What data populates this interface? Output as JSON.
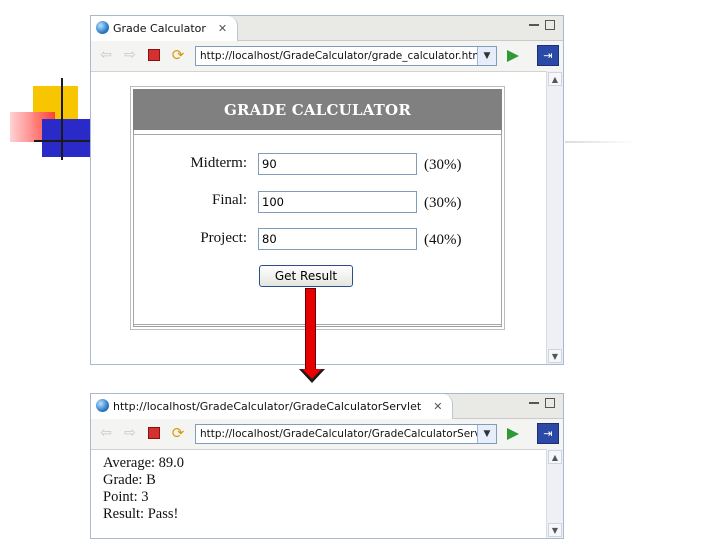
{
  "window1": {
    "tab_title": "Grade Calculator",
    "url": "http://localhost/GradeCalculator/grade_calculator.html"
  },
  "form": {
    "title": "GRADE CALCULATOR",
    "fields": [
      {
        "label": "Midterm:",
        "value": "90",
        "weight": "(30%)"
      },
      {
        "label": "Final:",
        "value": "100",
        "weight": "(30%)"
      },
      {
        "label": "Project:",
        "value": "80",
        "weight": "(40%)"
      }
    ],
    "submit_label": "Get Result"
  },
  "window2": {
    "tab_title": "http://localhost/GradeCalculator/GradeCalculatorServlet",
    "url": "http://localhost/GradeCalculator/GradeCalculatorServlet"
  },
  "result": {
    "lines": [
      "Average: 89.0",
      "Grade: B",
      "Point: 3",
      "Result: Pass!"
    ]
  },
  "icons": {
    "back": "back-arrow-icon",
    "forward": "forward-arrow-icon",
    "stop": "stop-icon",
    "refresh": "refresh-icon",
    "go": "go-icon",
    "eclipse": "eclipse-icon"
  },
  "colors": {
    "header_bg": "#808080",
    "arrow": "#e60000",
    "go": "#2f9a35"
  }
}
